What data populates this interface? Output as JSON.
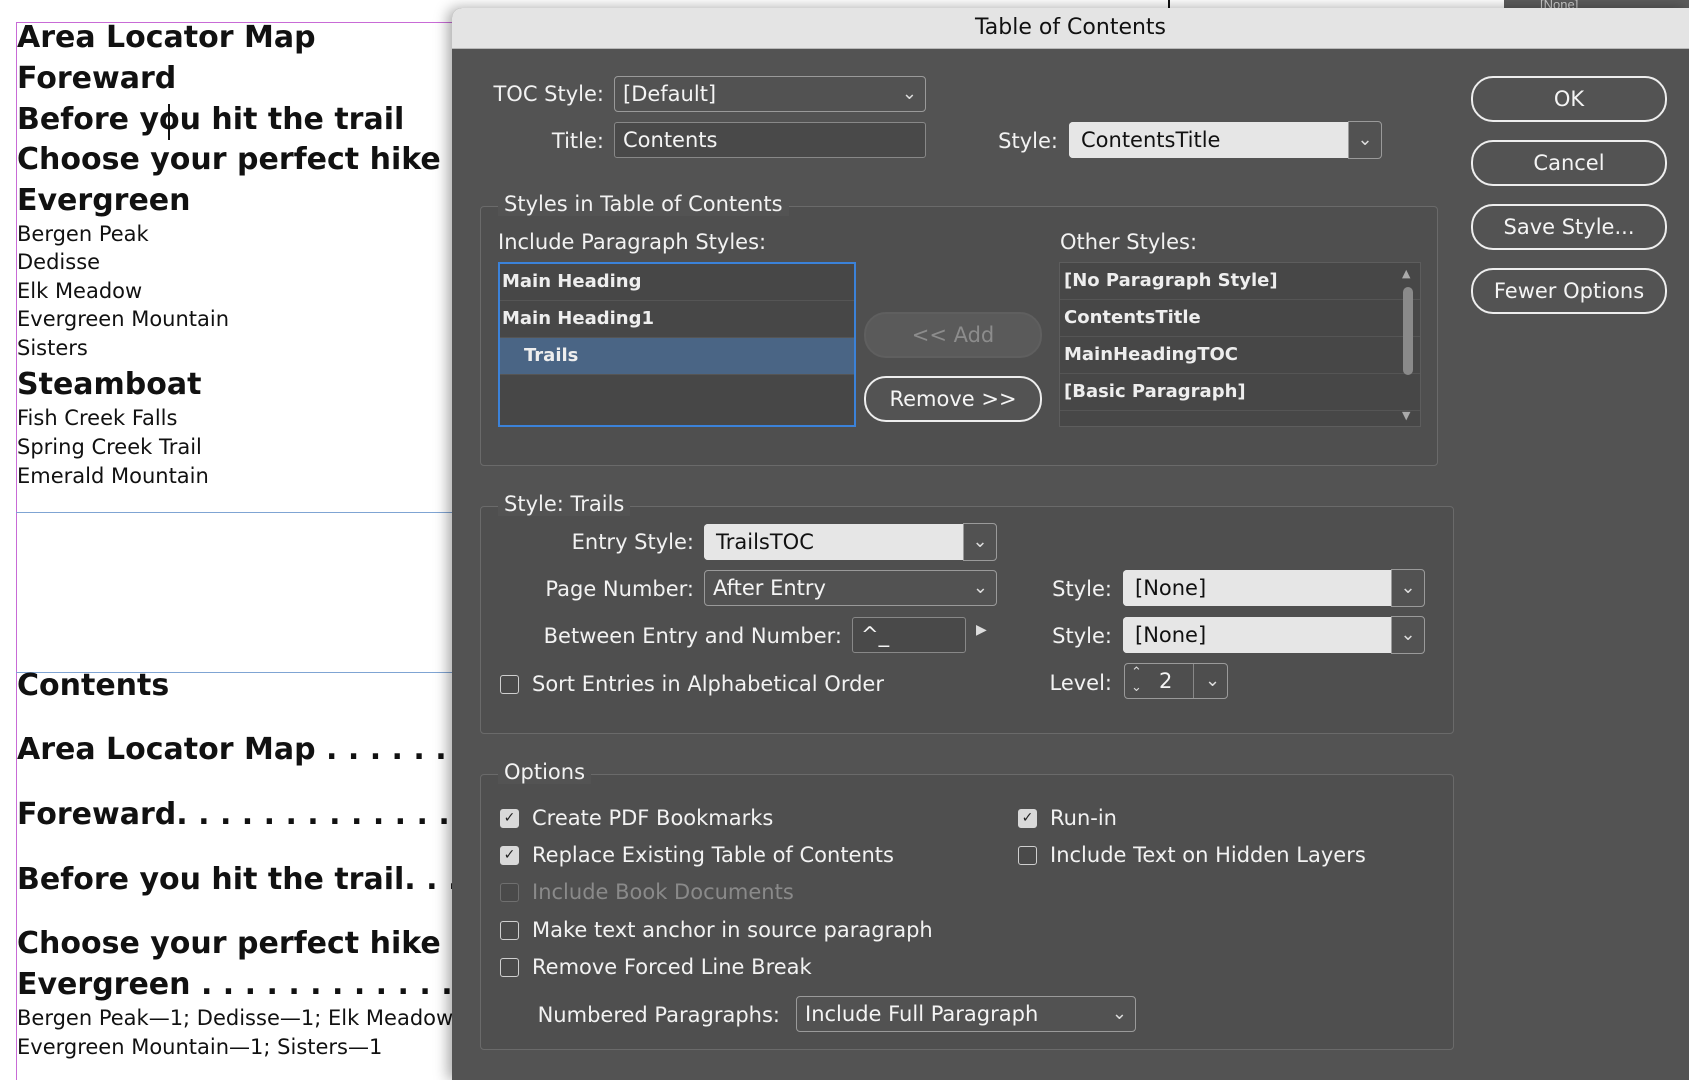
{
  "document": {
    "top_label": "[None]",
    "headings": [
      "Area Locator Map",
      "Foreward",
      "Before you hit the trail",
      "Choose your perfect hike",
      "Evergreen"
    ],
    "evergreen_trails": [
      "Bergen Peak",
      "Dedisse",
      "Elk Meadow",
      "Evergreen Mountain",
      "Sisters"
    ],
    "steamboat_heading": "Steamboat",
    "steamboat_trails": [
      "Fish Creek Falls",
      "Spring Creek Trail",
      "Emerald Mountain"
    ],
    "toc": {
      "title": "Contents",
      "entries": [
        "Area Locator Map . . . . . . . . . .",
        "Foreward. . . . . . . . . . . . . . . . . . .",
        "Before you hit the trail. . . . . .",
        "Choose your perfect hike . . . .",
        "Evergreen . . . . . . . . . . . . . . . . ."
      ],
      "runin_line1": "Bergen Peak—1; Dedisse—1; Elk Meadow",
      "runin_line2": "Evergreen Mountain—1; Sisters—1"
    }
  },
  "dialog": {
    "title": "Table of Contents",
    "toc_style_label": "TOC Style:",
    "toc_style_value": "[Default]",
    "title_label": "Title:",
    "title_value": "Contents",
    "title_style_label": "Style:",
    "title_style_value": "ContentsTitle",
    "buttons": {
      "ok": "OK",
      "cancel": "Cancel",
      "save_style": "Save Style...",
      "fewer_options": "Fewer Options"
    },
    "styles_group": {
      "title": "Styles in Table of Contents",
      "include_label": "Include Paragraph Styles:",
      "include_items": [
        "Main Heading",
        "Main Heading1",
        "Trails"
      ],
      "selected_item": "Trails",
      "other_label": "Other Styles:",
      "other_items": [
        "[No Paragraph Style]",
        "ContentsTitle",
        "MainHeadingTOC",
        "[Basic Paragraph]"
      ],
      "add_label": "<< Add",
      "remove_label": "Remove >>"
    },
    "style_group": {
      "title": "Style: Trails",
      "entry_style_label": "Entry Style:",
      "entry_style_value": "TrailsTOC",
      "page_number_label": "Page Number:",
      "page_number_value": "After Entry",
      "page_number_style_label": "Style:",
      "page_number_style_value": "[None]",
      "between_label": "Between Entry and Number:",
      "between_value": "^_",
      "between_style_label": "Style:",
      "between_style_value": "[None]",
      "sort_label": "Sort Entries in Alphabetical Order",
      "sort_checked": false,
      "level_label": "Level:",
      "level_value": "2"
    },
    "options_group": {
      "title": "Options",
      "create_pdf_bookmarks": "Create PDF Bookmarks",
      "replace_existing": "Replace Existing Table of Contents",
      "include_book_docs": "Include Book Documents",
      "make_text_anchor": "Make text anchor in source paragraph",
      "remove_forced_break": "Remove Forced Line Break",
      "run_in": "Run-in",
      "include_hidden_layers": "Include Text on Hidden Layers",
      "numbered_label": "Numbered Paragraphs:",
      "numbered_value": "Include Full Paragraph"
    }
  },
  "colors": {
    "dialog_bg": "#535353",
    "selection": "#4a6585",
    "focus_ring": "#3b82d9",
    "guide": "#c86bd6"
  }
}
